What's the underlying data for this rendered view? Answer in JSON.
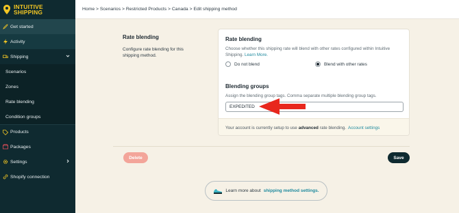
{
  "brand": {
    "line1": "INTUITIVE",
    "line2": "SHIPPING",
    "color": "#f3c623"
  },
  "breadcrumb": "Home > Scenarios > Restricted Products > Canada > Edit shipping method",
  "sidebar": {
    "items": [
      {
        "label": "Get started",
        "icon": "rocket-icon"
      },
      {
        "label": "Activity",
        "icon": "lightning-icon"
      },
      {
        "label": "Shipping",
        "icon": "truck-icon",
        "expanded": true
      },
      {
        "label": "Scenarios"
      },
      {
        "label": "Zones"
      },
      {
        "label": "Rate blending"
      },
      {
        "label": "Condition groups"
      },
      {
        "label": "Products",
        "icon": "tag-icon"
      },
      {
        "label": "Packages",
        "icon": "box-icon"
      },
      {
        "label": "Settings",
        "icon": "gear-icon"
      },
      {
        "label": "Shopify connection",
        "icon": "link-icon"
      }
    ]
  },
  "section": {
    "title": "Rate blending",
    "description": "Configure rate blending for this shipping method."
  },
  "card": {
    "title": "Rate blending",
    "help": "Choose whether this shipping rate will blend with other rates configured within Intuitive Shipping.",
    "help_link": "Learn More.",
    "options": [
      {
        "label": "Do not blend",
        "selected": false
      },
      {
        "label": "Blend with other rates",
        "selected": true
      }
    ],
    "groups_title": "Blending groups",
    "groups_help": "Assign the blending group tags. Comma separate multiple blending group tags.",
    "groups_value": "EXPEDITED",
    "footer_pre": "Your account is currently setup to use",
    "footer_bold": "advanced",
    "footer_post": "rate blending.",
    "footer_link": "Account settings"
  },
  "buttons": {
    "delete": "Delete",
    "save": "Save"
  },
  "learn": {
    "pre": "Learn more about",
    "link": "shipping method settings."
  },
  "colors": {
    "accent": "#1f8a9e",
    "danger_light": "#f3a59a",
    "dark": "#0f2a30",
    "arrow": "#e8271d"
  }
}
